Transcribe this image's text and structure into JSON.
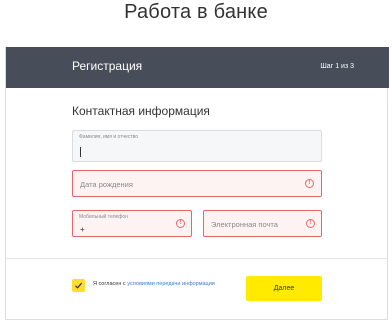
{
  "page": {
    "heading": "Работа в банке"
  },
  "card": {
    "title": "Регистрация",
    "step": "Шаг 1 из 3",
    "section_title": "Контактная информация"
  },
  "form": {
    "fio": {
      "label": "Фамилия, имя и отчество",
      "value": ""
    },
    "birth_date": {
      "placeholder": "Дата рождения",
      "state": "error"
    },
    "phone": {
      "label": "Мобильный телефон",
      "value": "+",
      "state": "error"
    },
    "email": {
      "placeholder": "Электронная почта",
      "state": "error"
    }
  },
  "footer": {
    "consent_checked": true,
    "consent_text": "Я согласен с",
    "consent_link": "условиями передачи информации",
    "next_label": "Далее"
  },
  "colors": {
    "header_bg": "#474d59",
    "accent_yellow": "#ffea00",
    "error": "#e8666b",
    "link": "#3d7dc8"
  },
  "icons": {
    "error": "exclamation-circle-icon",
    "checkbox": "checkmark-icon"
  }
}
